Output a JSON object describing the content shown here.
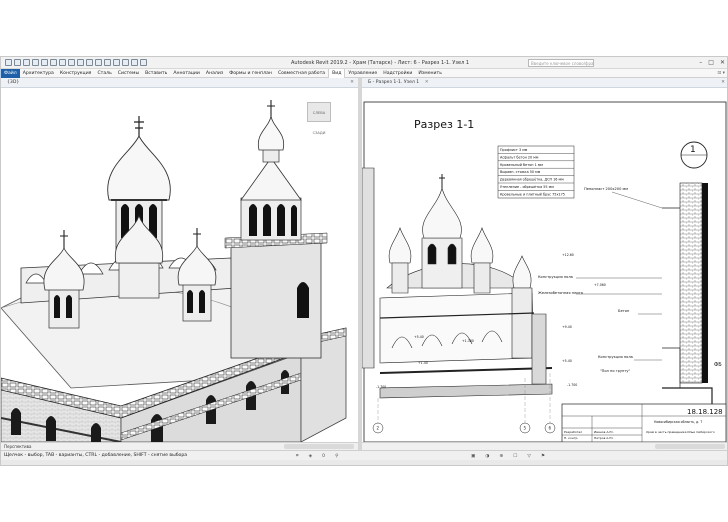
{
  "window": {
    "title": "Autodesk Revit 2019.2 - Храм (Татарск) - Лист: 6 - Разрез 1-1. Узел 1",
    "search_placeholder": "Введите ключевое слово/фразу",
    "controls": [
      "–",
      "□",
      "✕"
    ]
  },
  "ribbon": {
    "file_tab": "Файл",
    "tabs": [
      "Архитектура",
      "Конструкция",
      "Сталь",
      "Системы",
      "Вставить",
      "Аннотации",
      "Анализ",
      "Формы и генплан",
      "Совместная работа",
      "Вид",
      "Управление",
      "Надстройки",
      "Изменить"
    ],
    "active_tab": "Вид",
    "right_controls": "⊡ ▾"
  },
  "left_view": {
    "tab_label": "{3D}",
    "close": "✕",
    "viewcube_label": "СЛЕВА СЗАДИ",
    "viewbar_label": "Перспектива"
  },
  "right_view": {
    "tab_label": "Б - Разрез 1-1. Узел 1",
    "tab_close": "✕",
    "pane_close": "✕",
    "viewbar_label": "",
    "sheet": {
      "section_title": "Разрез 1-1",
      "callout_number": "1",
      "layers": [
        "Профлист 3 мм",
        "Асфальт бетон 20 мм",
        "Кровельный бетон 1 мм",
        "Выравн. стяжка 50 мм",
        "Деревянная обрешётка, ДСП 16 мм",
        "Утепление - обрешётка 55 мм",
        "Кровельные и плитный брус 75х175"
      ],
      "notes": [
        "Пенопласт 200х200 мм",
        "Конструкция пола",
        "Железобетонная плита",
        "Бетон",
        "Конструкция пола",
        "\"Пол по грунту\""
      ],
      "levels": [
        "+12.60",
        "+9.40",
        "+5.40",
        "+1.380",
        "+5.40",
        "+1.40",
        "-1.700",
        "-1.700",
        "+7.060"
      ],
      "grid_markers": [
        "2",
        "5",
        "6"
      ],
      "stamp_number": "18.18.128",
      "stamp_sub": "Новосибирская область, д. Т",
      "stamp_desc": "Храм в честь праведника Ильи Сибирского",
      "stamp_people": [
        "Разработал",
        "Н. контр."
      ],
      "stamp_names": [
        "Иванов А.Ю.",
        "Петров А.Ю."
      ],
      "side_letters": [
        "ФБ"
      ]
    }
  },
  "status": {
    "text": "Щелчок - выбор, TAB - варианты, CTRL - добавление, SHIFT - снятие выбора",
    "icons": [
      "⌗",
      "◈",
      "0",
      "⚲"
    ],
    "icons_right": [
      "▣",
      "◑",
      "⊕",
      "☐",
      "▽",
      "⚑"
    ]
  }
}
